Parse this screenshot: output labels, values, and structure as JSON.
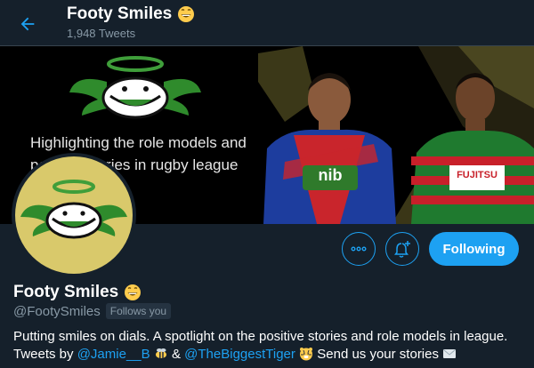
{
  "header": {
    "back_icon": "arrow-left-icon",
    "title": "Footy Smiles",
    "tweet_count": "1,948 Tweets"
  },
  "banner": {
    "line1": "Highlighting the role models and",
    "line2": "positive stories in rugby league",
    "jersey1_text": "nib",
    "jersey2_text": "FUJITSU"
  },
  "actions": {
    "more_icon": "more-dots-icon",
    "notify_icon": "bell-plus-icon",
    "following_label": "Following"
  },
  "profile": {
    "name": "Footy Smiles",
    "handle": "@FootySmiles",
    "follows_you": "Follows you",
    "bio_line1": "Putting smiles on dials. A spotlight on the positive stories and role models in league.",
    "bio_tweets_by": "Tweets by",
    "bio_link1": "@Jamie__B",
    "bio_amp": "&",
    "bio_link2": "@TheBiggestTiger",
    "bio_end": "Send us your stories"
  },
  "colors": {
    "background": "#15202b",
    "accent": "#1da1f2",
    "muted": "#8899a6"
  }
}
